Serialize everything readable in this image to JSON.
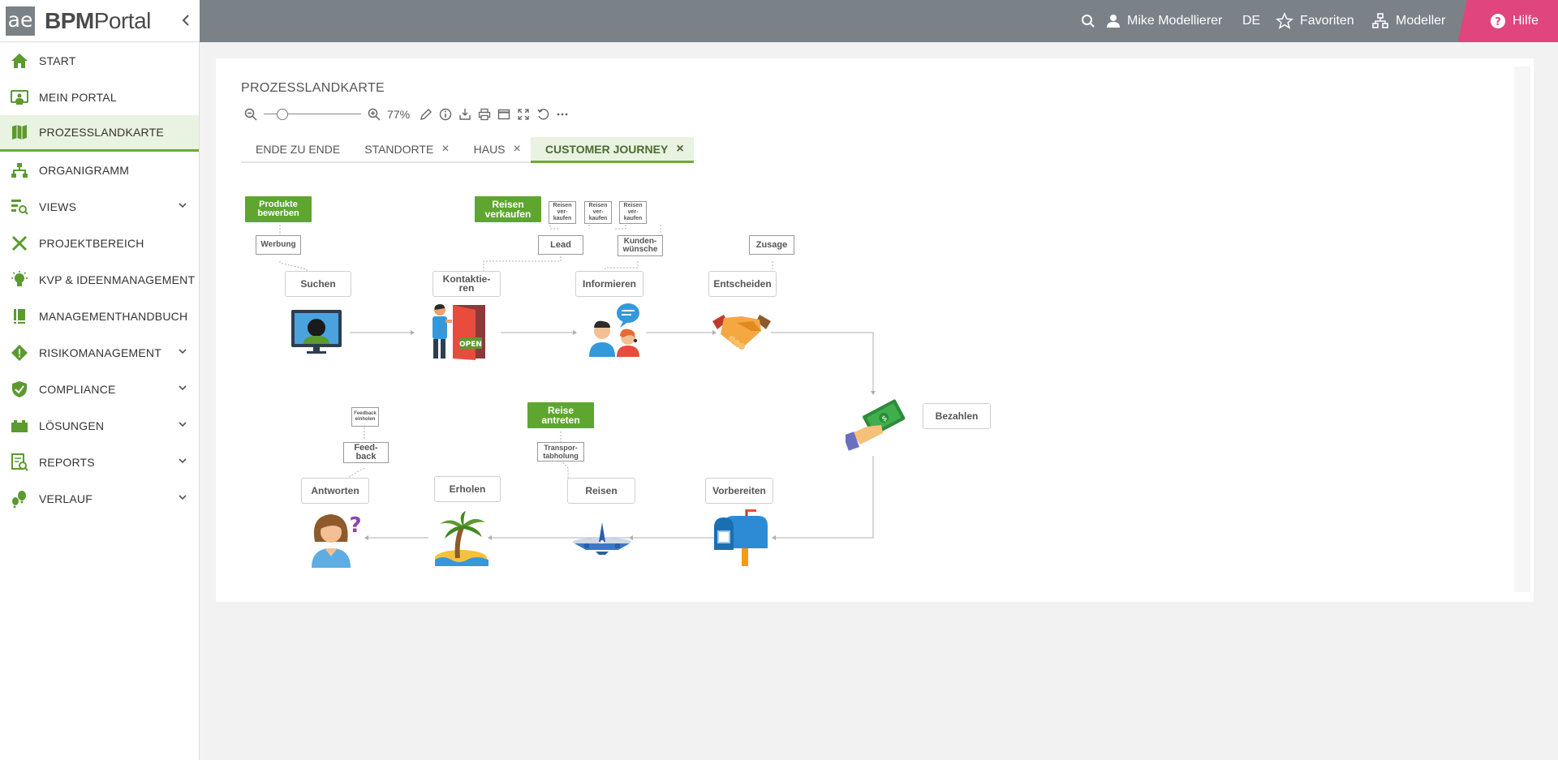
{
  "app": {
    "logo_mark": "ae",
    "logo_bold": "BPM",
    "logo_light": "Portal"
  },
  "topbar": {
    "user_name": "Mike Modellierer",
    "language": "DE",
    "favorites_label": "Favoriten",
    "modeler_label": "Modeller",
    "help_label": "Hilfe"
  },
  "sidebar": {
    "items": [
      {
        "label": "START",
        "icon": "home-icon",
        "has_chevron": false
      },
      {
        "label": "MEIN PORTAL",
        "icon": "portal-icon",
        "has_chevron": false
      },
      {
        "label": "PROZESSLANDKARTE",
        "icon": "map-icon",
        "has_chevron": false,
        "active": true
      },
      {
        "label": "ORGANIGRAMM",
        "icon": "org-chart-icon",
        "has_chevron": false
      },
      {
        "label": "VIEWS",
        "icon": "views-icon",
        "has_chevron": true
      },
      {
        "label": "PROJEKTBEREICH",
        "icon": "tools-icon",
        "has_chevron": false
      },
      {
        "label": "KVP & IDEENMANAGEMENT",
        "icon": "lightbulb-icon",
        "has_chevron": false
      },
      {
        "label": "MANAGEMENTHANDBUCH",
        "icon": "handbook-icon",
        "has_chevron": false
      },
      {
        "label": "RISIKOMANAGEMENT",
        "icon": "risk-icon",
        "has_chevron": true
      },
      {
        "label": "COMPLIANCE",
        "icon": "compliance-icon",
        "has_chevron": true
      },
      {
        "label": "LÖSUNGEN",
        "icon": "solutions-icon",
        "has_chevron": true
      },
      {
        "label": "REPORTS",
        "icon": "reports-icon",
        "has_chevron": true
      },
      {
        "label": "VERLAUF",
        "icon": "history-icon",
        "has_chevron": true
      }
    ]
  },
  "main": {
    "title": "PROZESSLANDKARTE",
    "zoom_level": "77%",
    "zoom_fraction": 0.15,
    "tabs": [
      {
        "label": "ENDE ZU ENDE",
        "closable": false,
        "active": false
      },
      {
        "label": "STANDORTE",
        "closable": true,
        "active": false
      },
      {
        "label": "HAUS",
        "closable": true,
        "active": false
      },
      {
        "label": "CUSTOMER JOURNEY",
        "closable": true,
        "active": true
      }
    ]
  },
  "diagram": {
    "steps": {
      "suchen": "Suchen",
      "kontaktieren_1": "Kontaktie-",
      "kontaktieren_2": "ren",
      "informieren": "Informieren",
      "entscheiden": "Entscheiden",
      "bezahlen": "Bezahlen",
      "vorbereiten": "Vorbereiten",
      "reisen": "Reisen",
      "erholen": "Erholen",
      "antworten": "Antworten"
    },
    "green_boxes": {
      "produkte_1": "Produkte",
      "produkte_2": "bewerben",
      "reisen_verkaufen_1": "Reisen",
      "reisen_verkaufen_2": "verkaufen",
      "reise_antreten_1": "Reise",
      "reise_antreten_2": "antreten"
    },
    "documents": {
      "werbung": "Werbung",
      "lead": "Lead",
      "kundenwuensche_1": "Kunden-",
      "kundenwuensche_2": "wünsche",
      "zusage": "Zusage",
      "small_reisen_1": "Reisen",
      "small_reisen_2": "ver-",
      "small_reisen_3": "kaufen",
      "transport_1": "Transpor-",
      "transport_2": "tabholung",
      "feedback_1": "Feed-",
      "feedback_2": "back",
      "feedback_small_1": "Feedback",
      "feedback_small_2": "einholen"
    },
    "open_sign": "OPEN"
  }
}
